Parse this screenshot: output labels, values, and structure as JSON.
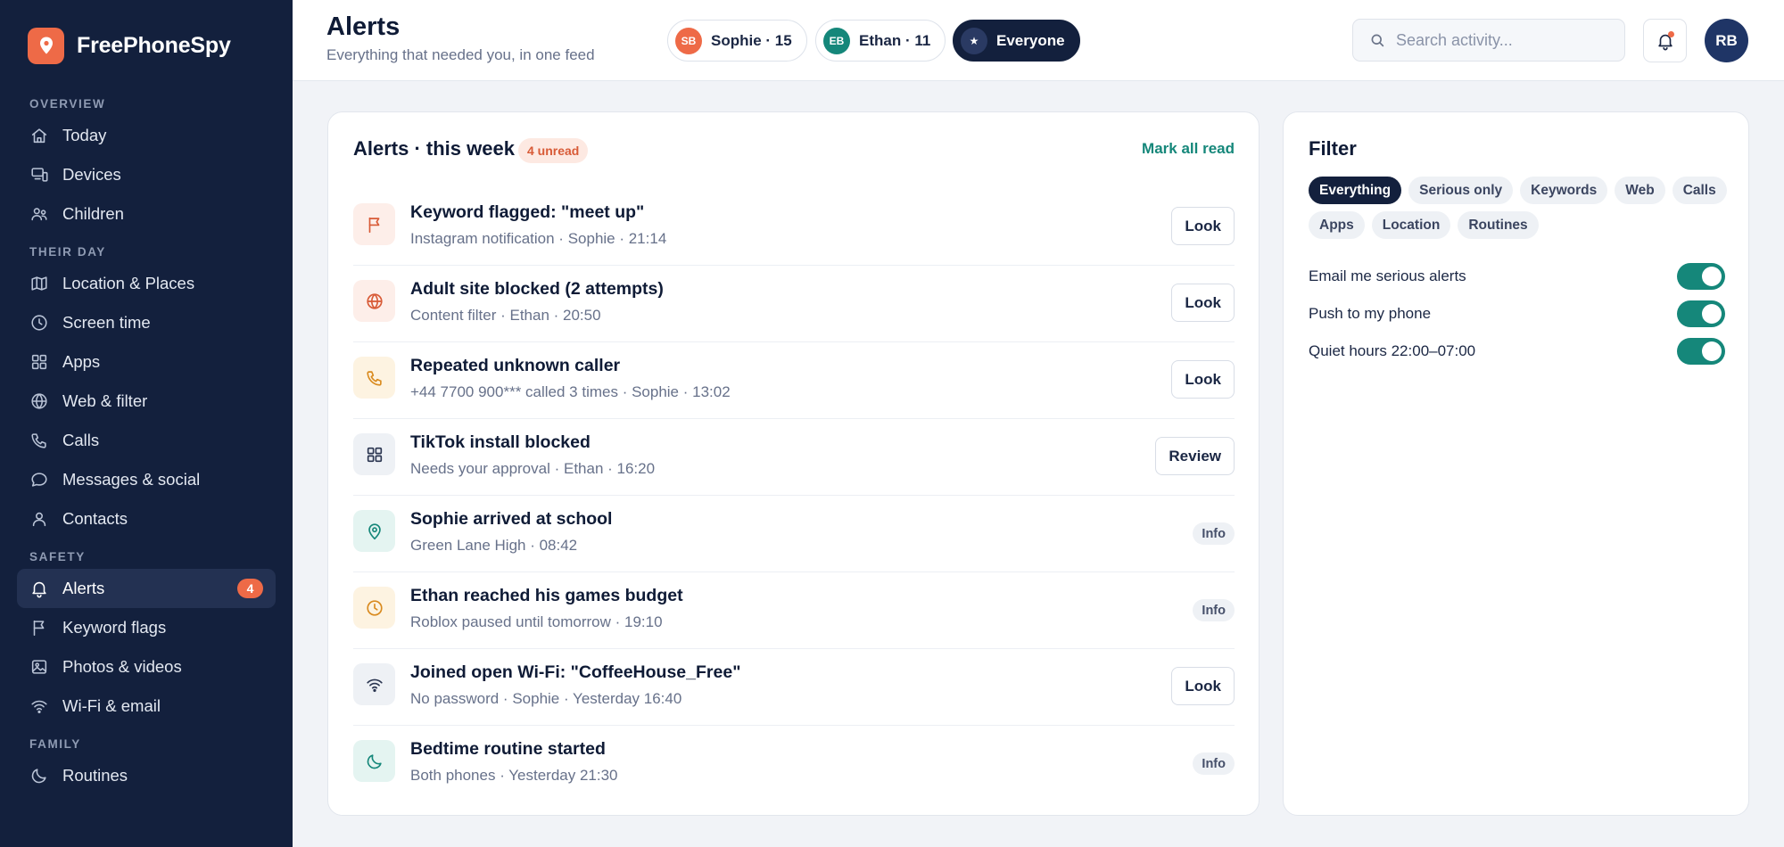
{
  "app": {
    "name": "FreePhoneSpy"
  },
  "colors": {
    "sidebar": "#13203d",
    "accent": "#ee6a47",
    "teal": "#15877a"
  },
  "sidebar": {
    "sections": [
      {
        "title": "OVERVIEW",
        "items": [
          {
            "label": "Today",
            "icon": "home-icon"
          },
          {
            "label": "Devices",
            "icon": "devices-icon"
          },
          {
            "label": "Children",
            "icon": "children-icon"
          }
        ]
      },
      {
        "title": "THEIR DAY",
        "items": [
          {
            "label": "Location & Places",
            "icon": "map-icon"
          },
          {
            "label": "Screen time",
            "icon": "clock-icon"
          },
          {
            "label": "Apps",
            "icon": "apps-grid-icon"
          },
          {
            "label": "Web & filter",
            "icon": "globe-icon"
          },
          {
            "label": "Calls",
            "icon": "phone-icon"
          },
          {
            "label": "Messages & social",
            "icon": "chat-bubble-icon"
          },
          {
            "label": "Contacts",
            "icon": "person-icon"
          }
        ]
      },
      {
        "title": "SAFETY",
        "items": [
          {
            "label": "Alerts",
            "icon": "bell-icon",
            "badge": "4",
            "active": true
          },
          {
            "label": "Keyword flags",
            "icon": "flag-icon"
          },
          {
            "label": "Photos & videos",
            "icon": "image-icon"
          },
          {
            "label": "Wi-Fi & email",
            "icon": "wifi-icon"
          }
        ]
      },
      {
        "title": "FAMILY",
        "items": [
          {
            "label": "Routines",
            "icon": "moon-icon"
          }
        ]
      }
    ]
  },
  "header": {
    "title": "Alerts",
    "subtitle": "Everything that needed you, in one feed",
    "scopes": [
      {
        "initials": "SB",
        "label": "Sophie · 15",
        "color": "#ee6a47"
      },
      {
        "initials": "EB",
        "label": "Ethan · 11",
        "color": "#15877a"
      },
      {
        "initials": "★",
        "label": "Everyone",
        "active": true
      }
    ],
    "search_placeholder": "Search activity...",
    "user_initials": "RB"
  },
  "alerts": {
    "title": "Alerts · this week",
    "unread": "4 unread",
    "mark_all": "Mark all read",
    "items": [
      {
        "title": "Keyword flagged: \"meet up\"",
        "meta": "Instagram notification · Sophie · 21:14",
        "icon": "flag-icon",
        "tone": "red",
        "action": "Look",
        "kind": "button"
      },
      {
        "title": "Adult site blocked (2 attempts)",
        "meta": "Content filter · Ethan · 20:50",
        "icon": "globe-icon",
        "tone": "red",
        "action": "Look",
        "kind": "button"
      },
      {
        "title": "Repeated unknown caller",
        "meta": "+44 7700 900*** called 3 times · Sophie · 13:02",
        "icon": "phone-icon",
        "tone": "amber",
        "action": "Look",
        "kind": "button"
      },
      {
        "title": "TikTok install blocked",
        "meta": "Needs your approval · Ethan · 16:20",
        "icon": "apps-grid-icon",
        "tone": "slate",
        "action": "Review",
        "kind": "button"
      },
      {
        "title": "Sophie arrived at school",
        "meta": "Green Lane High · 08:42",
        "icon": "location-pin-icon",
        "tone": "teal",
        "action": "Info",
        "kind": "pill"
      },
      {
        "title": "Ethan reached his games budget",
        "meta": "Roblox paused until tomorrow · 19:10",
        "icon": "clock-icon",
        "tone": "amber",
        "action": "Info",
        "kind": "pill"
      },
      {
        "title": "Joined open Wi-Fi: \"CoffeeHouse_Free\"",
        "meta": "No password · Sophie · Yesterday 16:40",
        "icon": "wifi-icon",
        "tone": "slate",
        "action": "Look",
        "kind": "button"
      },
      {
        "title": "Bedtime routine started",
        "meta": "Both phones · Yesterday 21:30",
        "icon": "moon-icon",
        "tone": "teal",
        "action": "Info",
        "kind": "pill"
      }
    ]
  },
  "filter": {
    "title": "Filter",
    "chips": [
      {
        "label": "Everything",
        "active": true
      },
      {
        "label": "Serious only"
      },
      {
        "label": "Keywords"
      },
      {
        "label": "Web"
      },
      {
        "label": "Calls"
      },
      {
        "label": "Apps"
      },
      {
        "label": "Location"
      },
      {
        "label": "Routines"
      }
    ],
    "settings": [
      {
        "label": "Email me serious alerts",
        "on": true
      },
      {
        "label": "Push to my phone",
        "on": true
      },
      {
        "label": "Quiet hours 22:00–07:00",
        "on": true
      }
    ]
  }
}
